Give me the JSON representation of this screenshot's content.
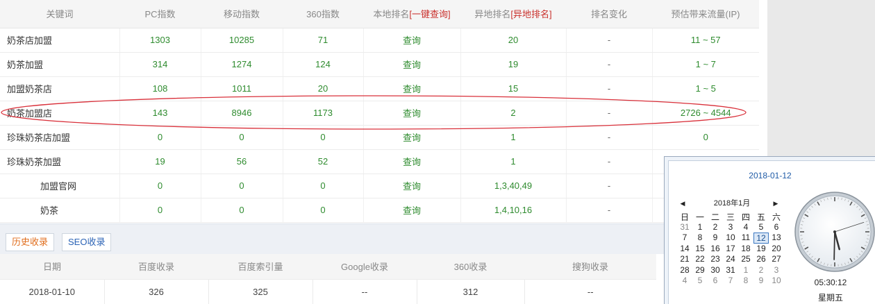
{
  "keyword_table": {
    "headers": {
      "keyword": "关键词",
      "pc_index": "PC指数",
      "mobile_index": "移动指数",
      "index_360": "360指数",
      "local_rank": "本地排名",
      "local_rank_link": "[一键查询]",
      "remote_rank": "异地排名",
      "remote_rank_link": "[异地排名]",
      "rank_change": "排名变化",
      "estimated_traffic": "预估带来流量(IP)"
    },
    "rows": [
      {
        "keyword": "奶茶店加盟",
        "pc": "1303",
        "mobile": "10285",
        "i360": "71",
        "local": "查询",
        "remote": "20",
        "change": "-",
        "traffic": "11 ~ 57"
      },
      {
        "keyword": "奶茶加盟",
        "pc": "314",
        "mobile": "1274",
        "i360": "124",
        "local": "查询",
        "remote": "19",
        "change": "-",
        "traffic": "1 ~ 7"
      },
      {
        "keyword": "加盟奶茶店",
        "pc": "108",
        "mobile": "1011",
        "i360": "20",
        "local": "查询",
        "remote": "15",
        "change": "-",
        "traffic": "1 ~ 5"
      },
      {
        "keyword": "奶茶加盟店",
        "pc": "143",
        "mobile": "8946",
        "i360": "1173",
        "local": "查询",
        "remote": "2",
        "change": "-",
        "traffic": "2726 ~ 4544"
      },
      {
        "keyword": "珍珠奶茶店加盟",
        "pc": "0",
        "mobile": "0",
        "i360": "0",
        "local": "查询",
        "remote": "1",
        "change": "-",
        "traffic": "0"
      },
      {
        "keyword": "珍珠奶茶加盟",
        "pc": "19",
        "mobile": "56",
        "i360": "52",
        "local": "查询",
        "remote": "1",
        "change": "-",
        "traffic": ""
      },
      {
        "keyword": "加盟官网",
        "pc": "0",
        "mobile": "0",
        "i360": "0",
        "local": "查询",
        "remote": "1,3,40,49",
        "change": "-",
        "traffic": ""
      },
      {
        "keyword": "奶茶",
        "pc": "0",
        "mobile": "0",
        "i360": "0",
        "local": "查询",
        "remote": "1,4,10,16",
        "change": "-",
        "traffic": ""
      }
    ]
  },
  "tabs": {
    "history": "历史收录",
    "seo": "SEO收录"
  },
  "history_table": {
    "headers": [
      "日期",
      "百度收录",
      "百度索引量",
      "Google收录",
      "360收录",
      "搜狗收录"
    ],
    "rows": [
      [
        "2018-01-10",
        "326",
        "325",
        "--",
        "312",
        "--"
      ]
    ]
  },
  "flyout": {
    "date_link": "2018-01-12",
    "month_label": "2018年1月",
    "weekdays": [
      "日",
      "一",
      "二",
      "三",
      "四",
      "五",
      "六"
    ],
    "days": [
      [
        "31",
        "1",
        "2",
        "3",
        "4",
        "5",
        "6"
      ],
      [
        "7",
        "8",
        "9",
        "10",
        "11",
        "12",
        "13"
      ],
      [
        "14",
        "15",
        "16",
        "17",
        "18",
        "19",
        "20"
      ],
      [
        "21",
        "22",
        "23",
        "24",
        "25",
        "26",
        "27"
      ],
      [
        "28",
        "29",
        "30",
        "31",
        "1",
        "2",
        "3"
      ],
      [
        "4",
        "5",
        "6",
        "7",
        "8",
        "9",
        "10"
      ]
    ],
    "today": "12",
    "time": "05:30:12",
    "weekday_label": "星期五",
    "clock": {
      "hour": 5,
      "minute": 30,
      "second": 12
    }
  },
  "colors": {
    "value_green": "#2e8b2e",
    "highlight_red": "#d9303a",
    "link_blue": "#1f5ba6",
    "tab_orange": "#e06d1c"
  }
}
